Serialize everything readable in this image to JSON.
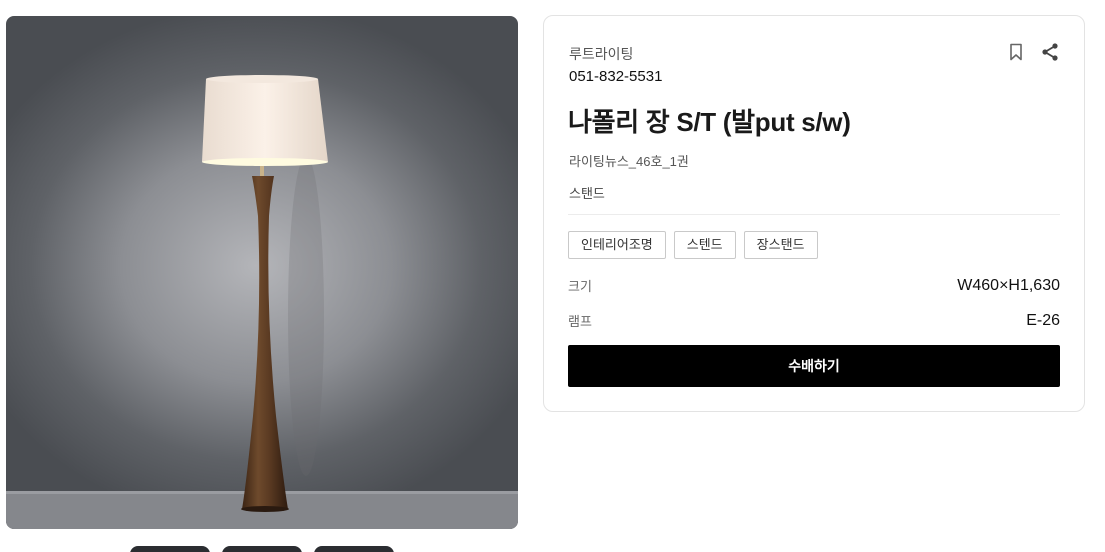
{
  "product": {
    "brand": "루트라이팅",
    "phone": "051-832-5531",
    "title": "나폴리 장 S/T (발put s/w)",
    "source": "라이팅뉴스_46호_1권",
    "category": "스탠드",
    "tags": [
      "인테리어조명",
      "스텐드",
      "장스탠드"
    ],
    "specs": [
      {
        "label": "크기",
        "value": "W460×H1,630"
      },
      {
        "label": "램프",
        "value": "E-26"
      }
    ],
    "order_label": "수배하기"
  },
  "icons": {
    "bookmark": "bookmark-icon",
    "share": "share-icon"
  },
  "colors": {
    "button_bg": "#000000",
    "button_text": "#ffffff"
  }
}
